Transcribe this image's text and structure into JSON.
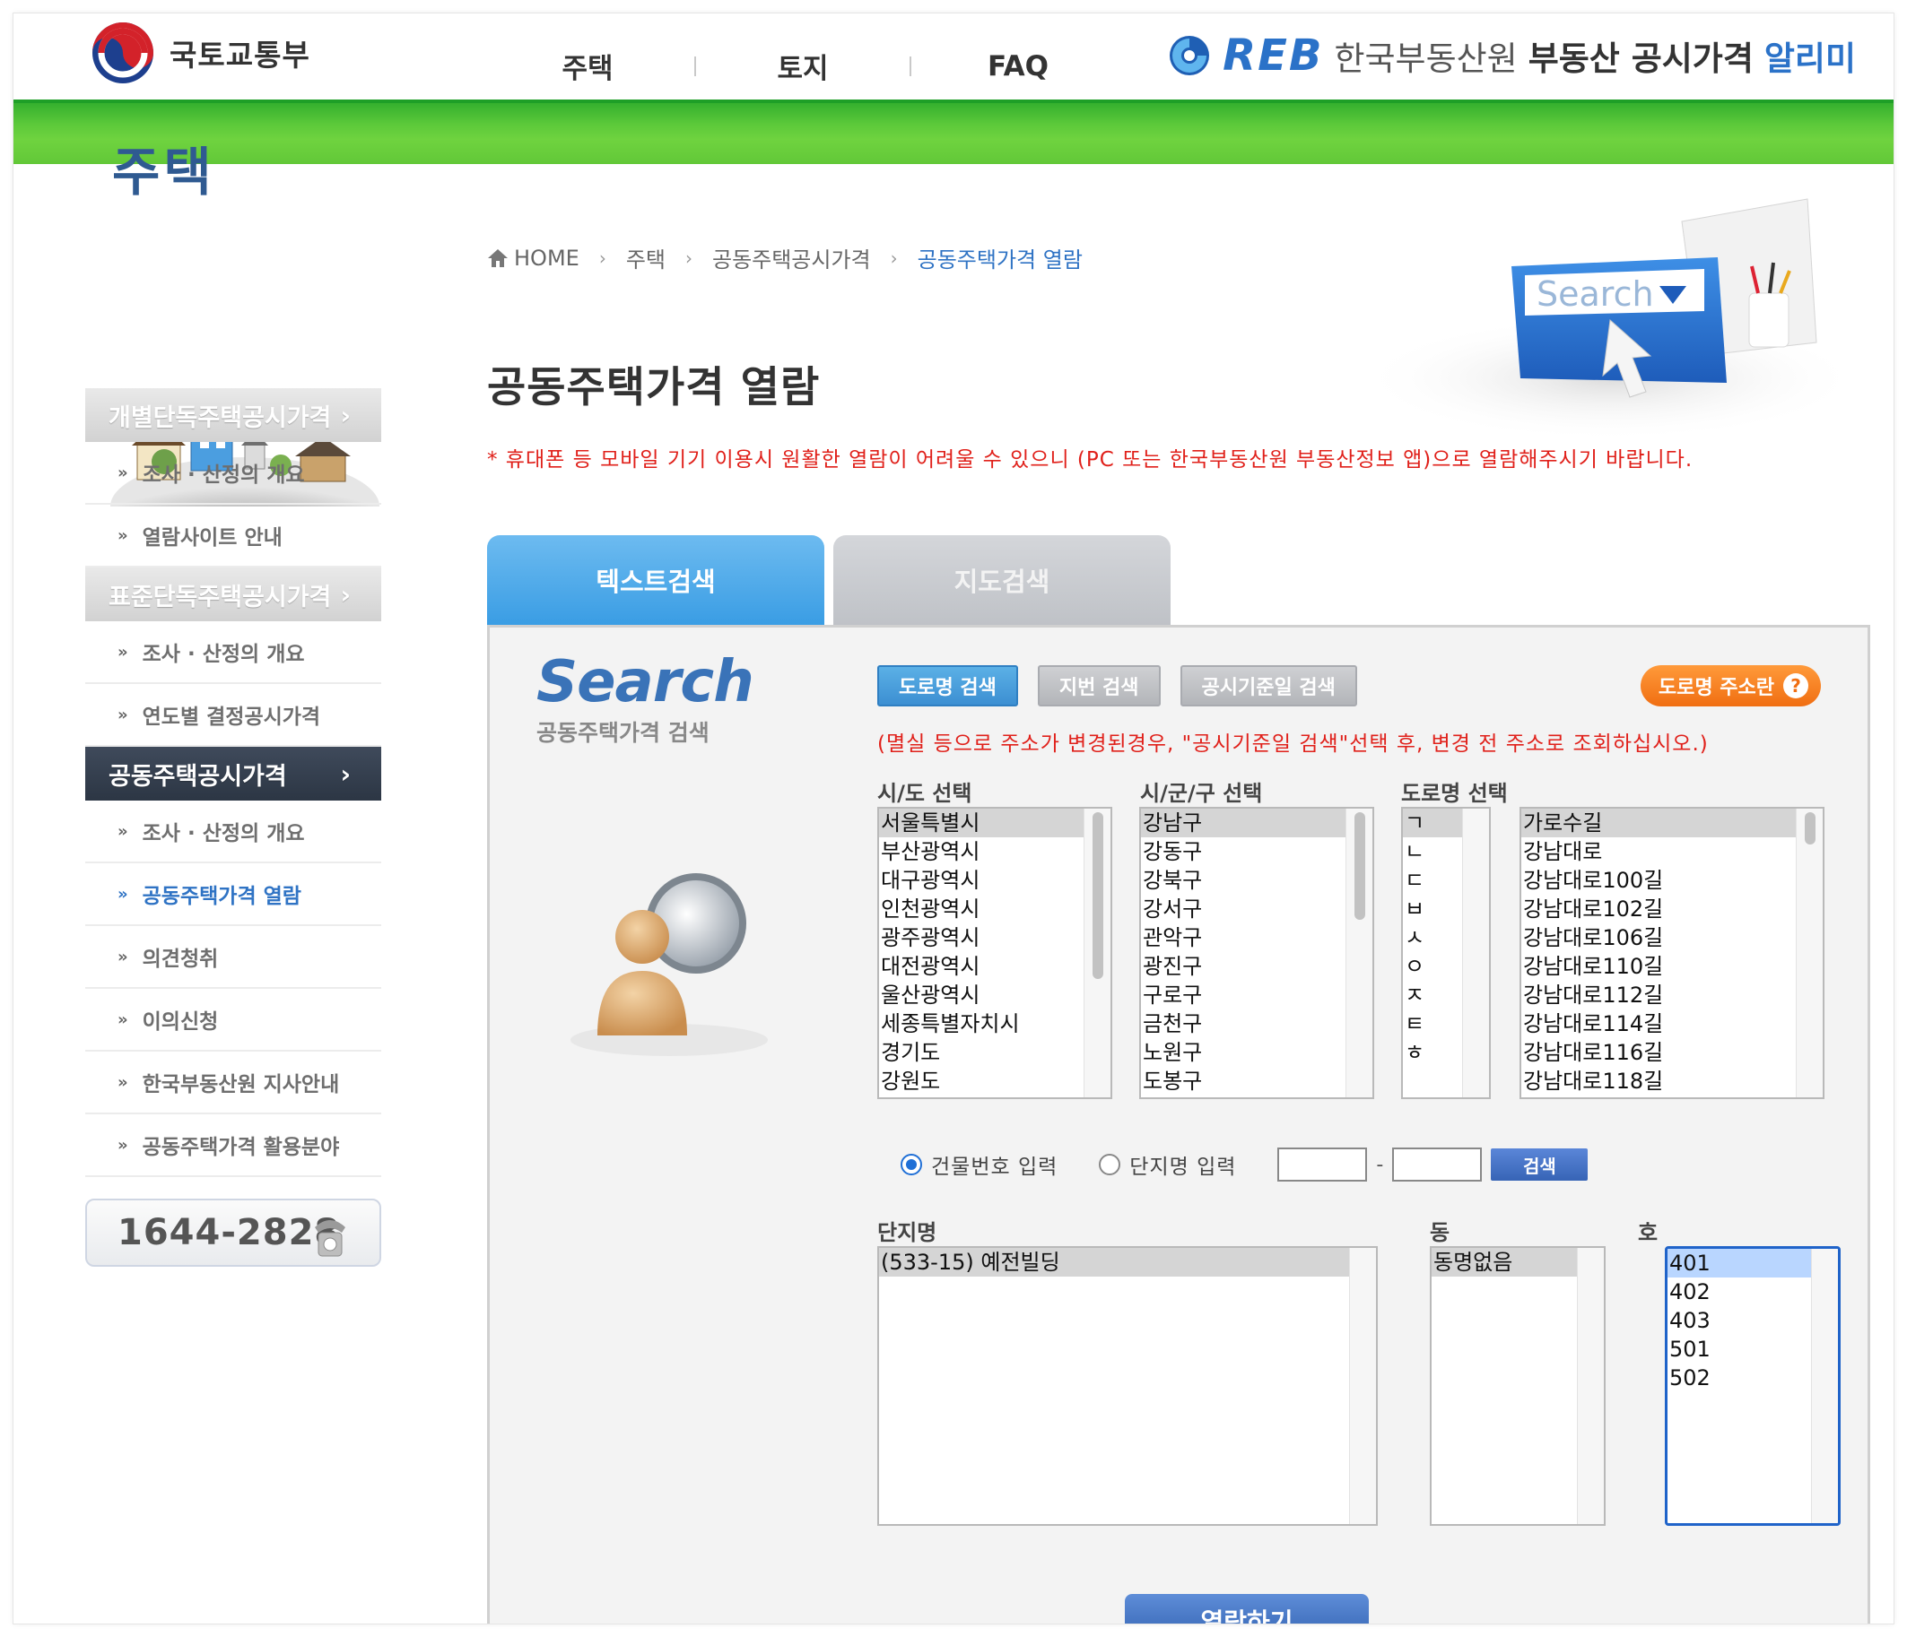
{
  "header": {
    "ministry_name": "국토교통부",
    "nav": [
      "주택",
      "토지",
      "FAQ"
    ],
    "brand_reb": "REB",
    "brand_korean": "한국부동산원",
    "brand_service": "부동산 공시가격",
    "brand_alimi": "알리미",
    "colors": {
      "green_band": "#5cc93a",
      "brand_blue": "#2b72c8"
    }
  },
  "sidebar": {
    "title": "주택",
    "sections": [
      {
        "label": "개별단독주택공시가격",
        "active": false,
        "items": [
          {
            "label": "조사 · 산정의 개요"
          },
          {
            "label": "열람사이트 안내"
          }
        ]
      },
      {
        "label": "표준단독주택공시가격",
        "active": false,
        "items": [
          {
            "label": "조사 · 산정의 개요"
          },
          {
            "label": "연도별 결정공시가격"
          }
        ]
      },
      {
        "label": "공동주택공시가격",
        "active": true,
        "items": [
          {
            "label": "조사 · 산정의 개요"
          },
          {
            "label": "공동주택가격 열람",
            "active": true
          },
          {
            "label": "의견청취"
          },
          {
            "label": "이의신청"
          },
          {
            "label": "한국부동산원 지사안내"
          },
          {
            "label": "공동주택가격 활용분야"
          }
        ]
      }
    ],
    "phone": "1644-2828"
  },
  "breadcrumb": [
    "HOME",
    "주택",
    "공동주택공시가격",
    "공동주택가격 열람"
  ],
  "page_title": "공동주택가격 열람",
  "notice": "* 휴대폰 등 모바일 기기 이용시 원활한 열람이 어려울 수 있으니 (PC 또는 한국부동산원 부동산정보 앱)으로 열람해주시기 바랍니다.",
  "hero_search_text": "Search",
  "tabs": [
    {
      "label": "텍스트검색",
      "active": true
    },
    {
      "label": "지도검색",
      "active": false
    }
  ],
  "search": {
    "logo_title": "Search",
    "logo_sub": "공동주택가격 검색",
    "sub_tabs": [
      {
        "label": "도로명 검색",
        "active": true
      },
      {
        "label": "지번 검색",
        "active": false
      },
      {
        "label": "공시기준일 검색",
        "active": false
      }
    ],
    "road_help_label": "도로명 주소란",
    "road_help_icon": "?",
    "sub_notice": "(멸실 등으로 주소가 변경된경우, \"공시기준일 검색\"선택 후, 변경 전 주소로 조회하십시오.)",
    "labels": {
      "sido": "시/도 선택",
      "sigungu": "시/군/구 선택",
      "road": "도로명 선택"
    },
    "sido_options": [
      "서울특별시",
      "부산광역시",
      "대구광역시",
      "인천광역시",
      "광주광역시",
      "대전광역시",
      "울산광역시",
      "세종특별자치시",
      "경기도",
      "강원도"
    ],
    "sigungu_options": [
      "강남구",
      "강동구",
      "강북구",
      "강서구",
      "관악구",
      "광진구",
      "구로구",
      "금천구",
      "노원구",
      "도봉구"
    ],
    "initial_options": [
      "ㄱ",
      "ㄴ",
      "ㄷ",
      "ㅂ",
      "ㅅ",
      "ㅇ",
      "ㅈ",
      "ㅌ",
      "ㅎ"
    ],
    "road_options": [
      "가로수길",
      "강남대로",
      "강남대로100길",
      "강남대로102길",
      "강남대로106길",
      "강남대로110길",
      "강남대로112길",
      "강남대로114길",
      "강남대로116길",
      "강남대로118길"
    ],
    "radio_building": "건물번호 입력",
    "radio_complex": "단지명 입력",
    "dash": "-",
    "search_button": "검색",
    "complex_label": "단지명",
    "dong_label": "동",
    "ho_label": "호",
    "complex_options": [
      "(533-15) 예전빌딩"
    ],
    "dong_options": [
      "동명없음"
    ],
    "ho_options": [
      "401",
      "402",
      "403",
      "501",
      "502"
    ],
    "view_button": "열람하기"
  }
}
